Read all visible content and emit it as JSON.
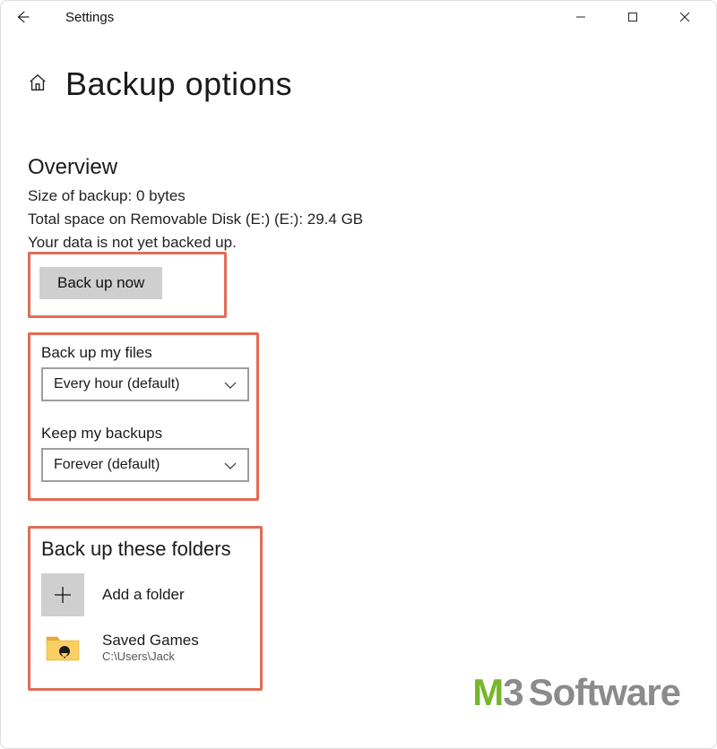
{
  "caption": {
    "app_title": "Settings"
  },
  "page": {
    "title": "Backup options"
  },
  "overview": {
    "heading": "Overview",
    "size_line": "Size of backup: 0 bytes",
    "space_line": "Total space on Removable Disk (E:) (E:): 29.4 GB",
    "status_line": "Your data is not yet backed up.",
    "backup_now_label": "Back up now"
  },
  "frequency": {
    "files_label": "Back up my files",
    "files_value": "Every hour (default)",
    "keep_label": "Keep my backups",
    "keep_value": "Forever (default)"
  },
  "folders": {
    "heading": "Back up these folders",
    "add_label": "Add a folder",
    "items": [
      {
        "name": "Saved Games",
        "path": "C:\\Users\\Jack"
      }
    ]
  },
  "watermark": {
    "m": "M",
    "three": "3",
    "rest": "Software"
  }
}
